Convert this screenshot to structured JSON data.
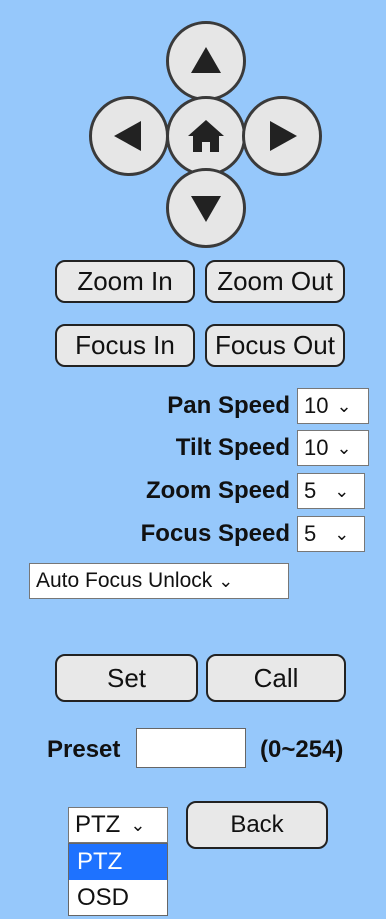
{
  "pad": {
    "up": "up-arrow",
    "down": "down-arrow",
    "left": "left-arrow",
    "right": "right-arrow",
    "home": "home"
  },
  "buttons": {
    "zoom_in": "Zoom In",
    "zoom_out": "Zoom Out",
    "focus_in": "Focus In",
    "focus_out": "Focus Out",
    "set": "Set",
    "call": "Call",
    "back": "Back"
  },
  "speeds": {
    "pan": {
      "label": "Pan Speed",
      "value": "10"
    },
    "tilt": {
      "label": "Tilt Speed",
      "value": "10"
    },
    "zoom": {
      "label": "Zoom Speed",
      "value": "5"
    },
    "focus": {
      "label": "Focus Speed",
      "value": "5"
    }
  },
  "auto_focus": {
    "value": "Auto Focus Unlock"
  },
  "preset": {
    "label": "Preset",
    "value": "",
    "range": "(0~254)"
  },
  "mode": {
    "value": "PTZ",
    "options": [
      "PTZ",
      "OSD"
    ],
    "highlighted": "PTZ"
  },
  "colors": {
    "background": "#96c8fb",
    "highlight": "#1e72ff"
  }
}
